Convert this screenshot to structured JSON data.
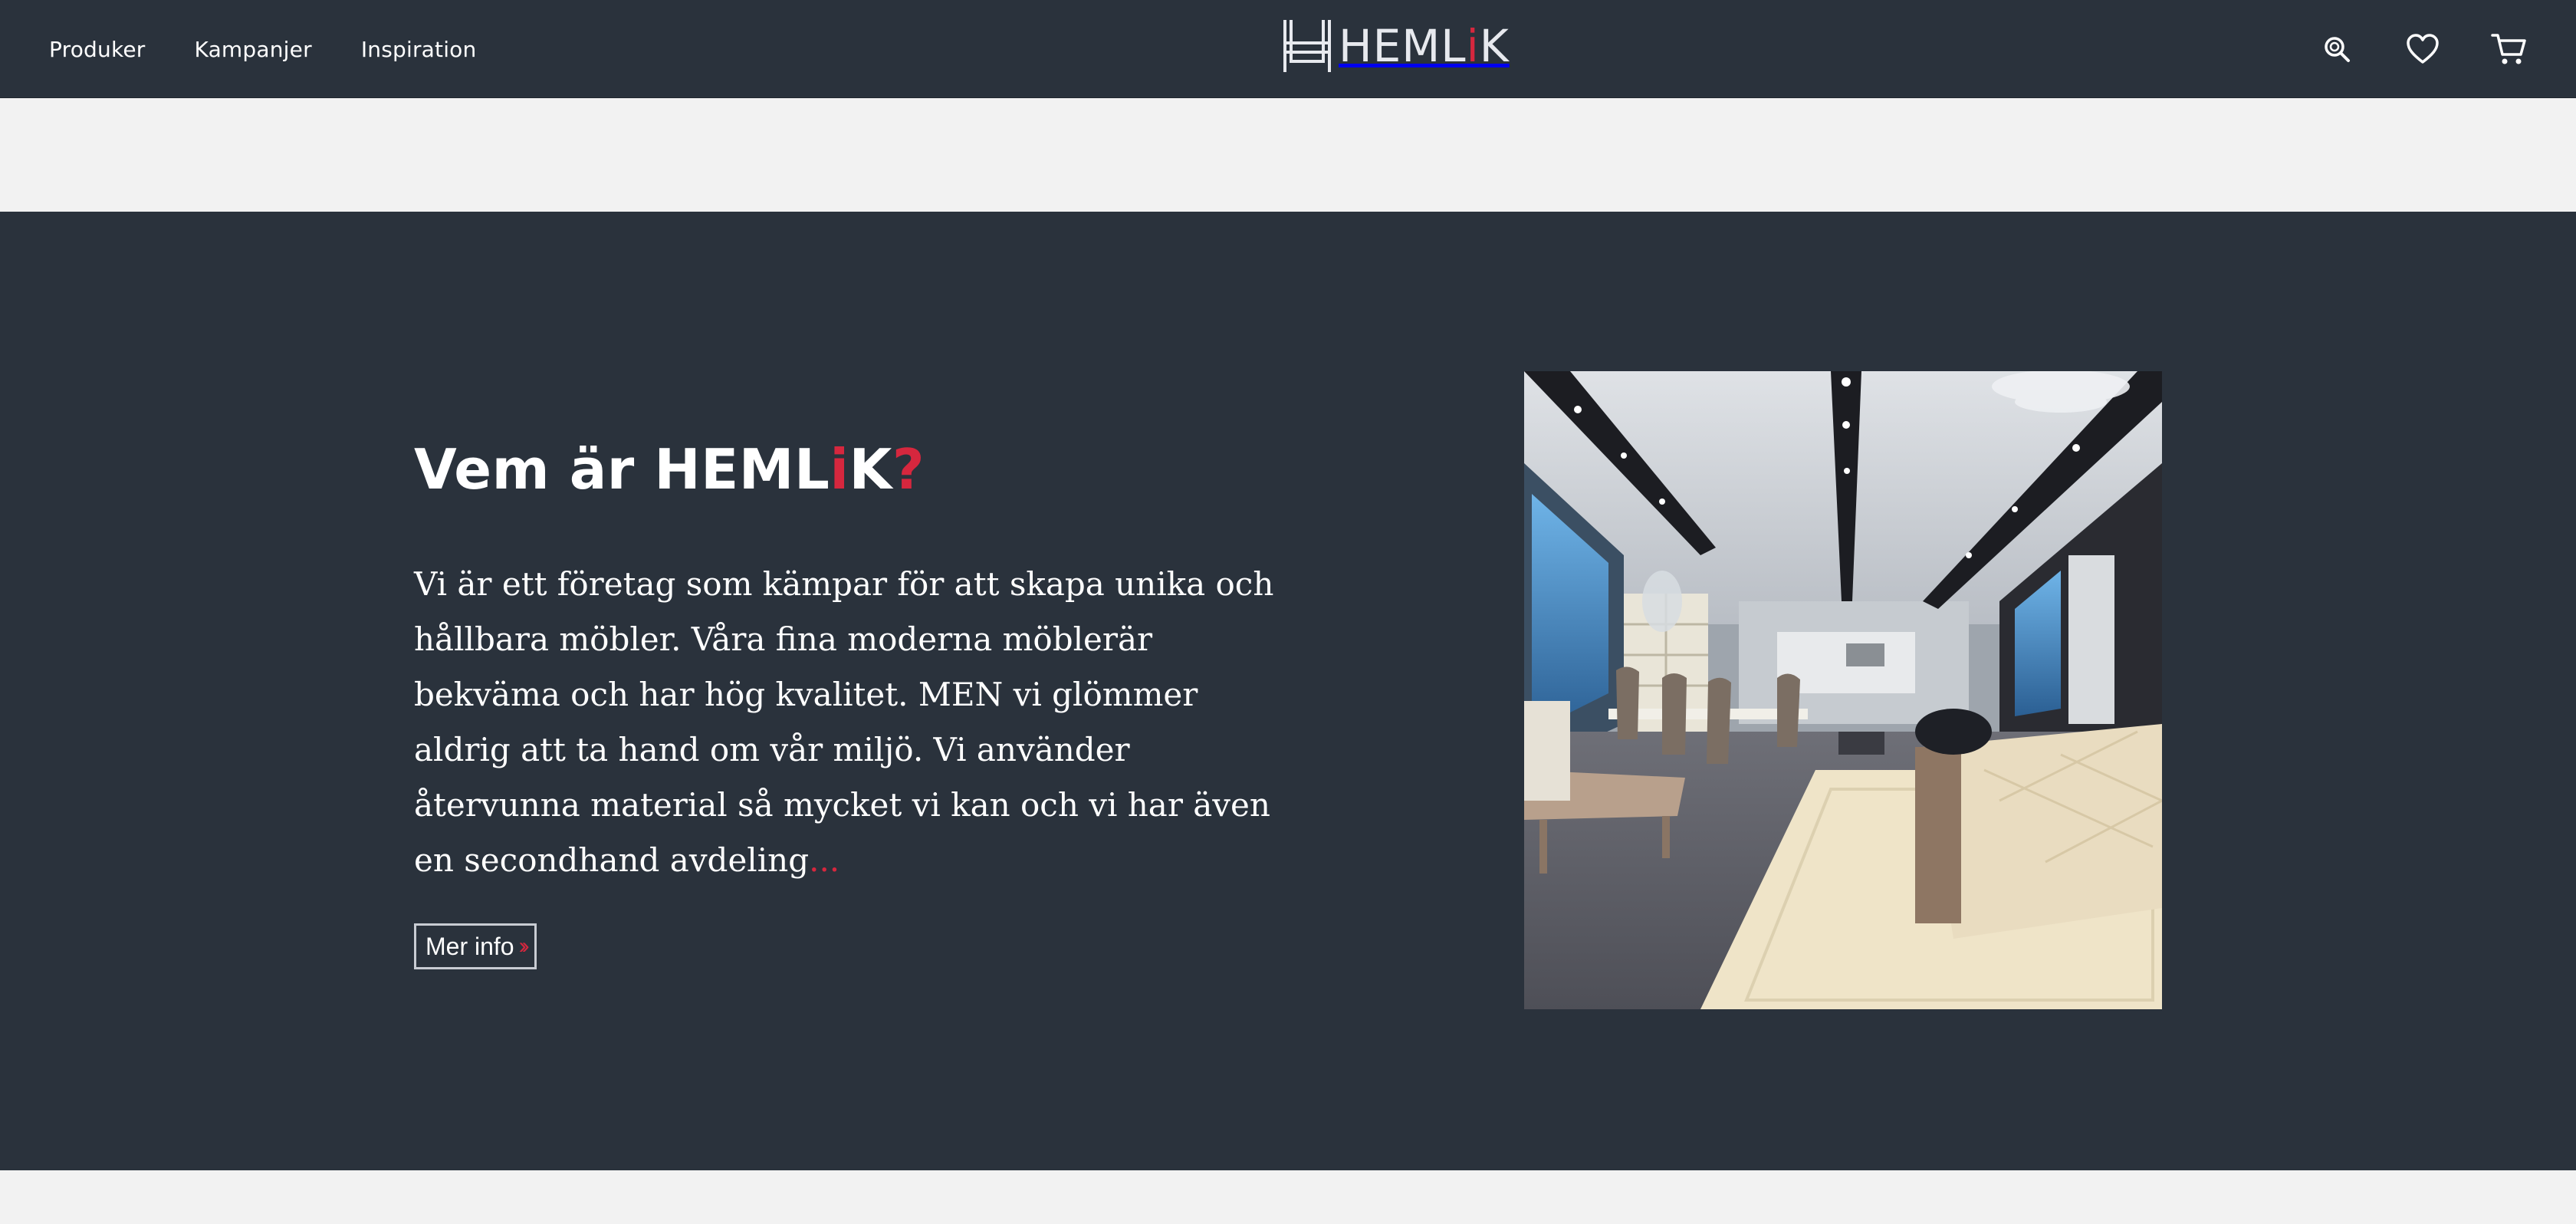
{
  "nav": {
    "items": [
      {
        "label": "Produker"
      },
      {
        "label": "Kampanjer"
      },
      {
        "label": "Inspiration"
      }
    ]
  },
  "logo": {
    "text_main": "HEML",
    "text_accent": "i",
    "text_end": "K"
  },
  "header_actions": {
    "icons": [
      "search-icon",
      "heart-icon",
      "cart-icon"
    ]
  },
  "hero": {
    "title_main": "Vem är HEML",
    "title_accent": "i",
    "title_end": "K",
    "title_question": "?",
    "body": "Vi är ett företag som kämpar för att skapa unika och hållbara möbler. Våra fina moderna möblerär bekväma och har hög kvalitet. MEN vi glömmer aldrig att ta hand om vår miljö. Vi använder återvunna material så mycket vi kan och vi har även en secondhand avdeling",
    "body_ellipsis": "...",
    "button_label": "Mer info",
    "button_icon": "double-chevron-right-icon",
    "image_alt": "furniture-showroom-image"
  },
  "colors": {
    "dark": "#2a323c",
    "light": "#f2f2f2",
    "accent": "#d6273e"
  }
}
